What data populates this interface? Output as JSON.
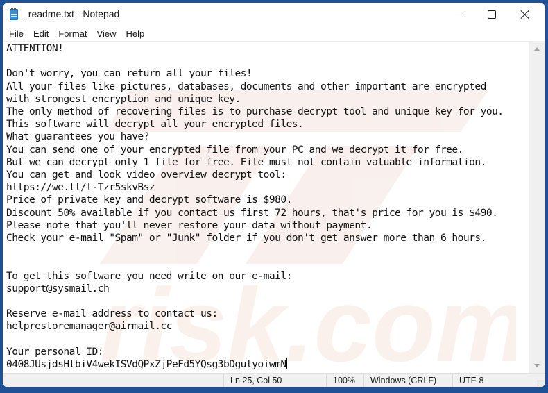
{
  "window": {
    "title": "_readme.txt - Notepad",
    "app_icon": "notepad-icon",
    "controls": {
      "minimize": "minimize-icon",
      "maximize": "maximize-icon",
      "close": "close-icon"
    }
  },
  "menu": {
    "items": [
      {
        "label": "File"
      },
      {
        "label": "Edit"
      },
      {
        "label": "Format"
      },
      {
        "label": "View"
      },
      {
        "label": "Help"
      }
    ]
  },
  "document": {
    "lines": [
      "ATTENTION!",
      "",
      "Don't worry, you can return all your files!",
      "All your files like pictures, databases, documents and other important are encrypted",
      "with strongest encryption and unique key.",
      "The only method of recovering files is to purchase decrypt tool and unique key for you.",
      "This software will decrypt all your encrypted files.",
      "What guarantees you have?",
      "You can send one of your encrypted file from your PC and we decrypt it for free.",
      "But we can decrypt only 1 file for free. File must not contain valuable information.",
      "You can get and look video overview decrypt tool:",
      "https://we.tl/t-Tzr5skvBsz",
      "Price of private key and decrypt software is $980.",
      "Discount 50% available if you contact us first 72 hours, that's price for you is $490.",
      "Please note that you'll never restore your data without payment.",
      "Check your e-mail \"Spam\" or \"Junk\" folder if you don't get answer more than 6 hours.",
      "",
      "",
      "To get this software you need write on our e-mail:",
      "support@sysmail.ch",
      "",
      "Reserve e-mail address to contact us:",
      "helprestoremanager@airmail.cc",
      "",
      "Your personal ID:",
      "0408JUsjdsHtbiV4wekISVdQPxZjPeFd5YQsg3bDgulyoiwmN"
    ]
  },
  "statusbar": {
    "position": "Ln 25, Col 50",
    "zoom": "100%",
    "line_ending": "Windows (CRLF)",
    "encoding": "UTF-8"
  },
  "colors": {
    "desktop_frame": "#1f5196",
    "window_bg": "#ffffff",
    "statusbar_bg": "#f0f0f0",
    "watermark": "#f5e6e0"
  }
}
